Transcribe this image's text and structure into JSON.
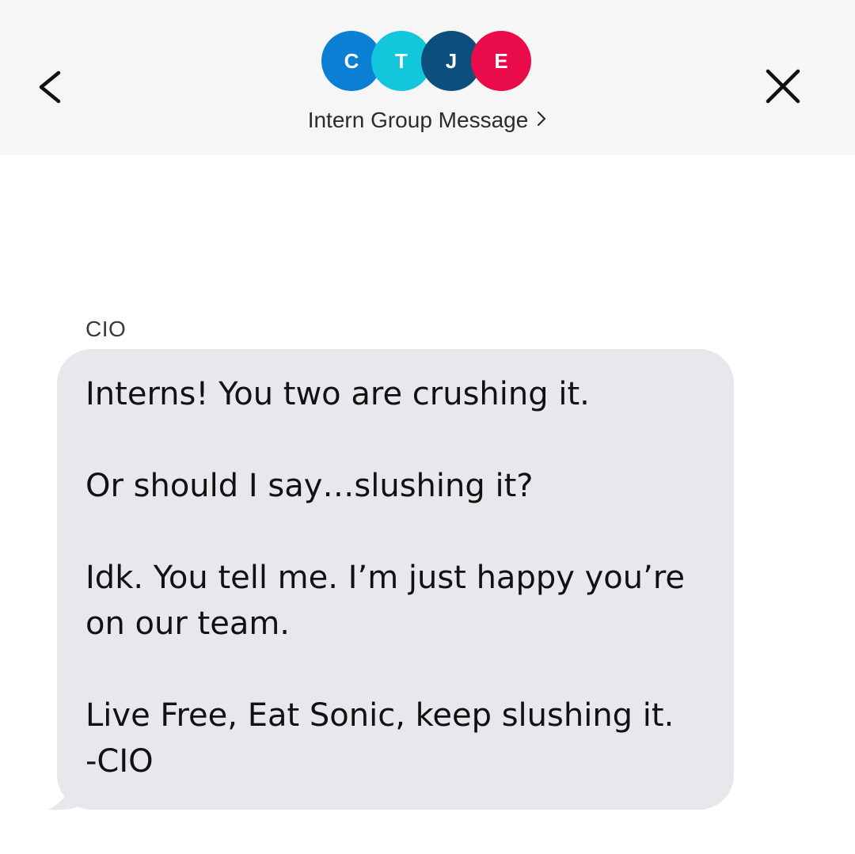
{
  "header": {
    "group_name": "Intern Group Message",
    "back_icon": "chevron-left-icon",
    "close_icon": "close-icon",
    "title_chevron_icon": "chevron-right-icon",
    "avatars": [
      {
        "initial": "C",
        "color": "#0a7fd4"
      },
      {
        "initial": "T",
        "color": "#12c6dc"
      },
      {
        "initial": "J",
        "color": "#0c4f7c"
      },
      {
        "initial": "E",
        "color": "#ea0c4a"
      }
    ]
  },
  "messages": [
    {
      "sender": "CIO",
      "bubble_color": "#e7e7ec",
      "lines": [
        "Interns! You two are crushing it.",
        "",
        "Or should I say…slushing it?",
        "",
        "Idk. You tell me. I’m just happy you’re",
        "on our team.",
        "",
        "Live Free, Eat Sonic, keep slushing it.",
        "-CIO"
      ]
    }
  ]
}
